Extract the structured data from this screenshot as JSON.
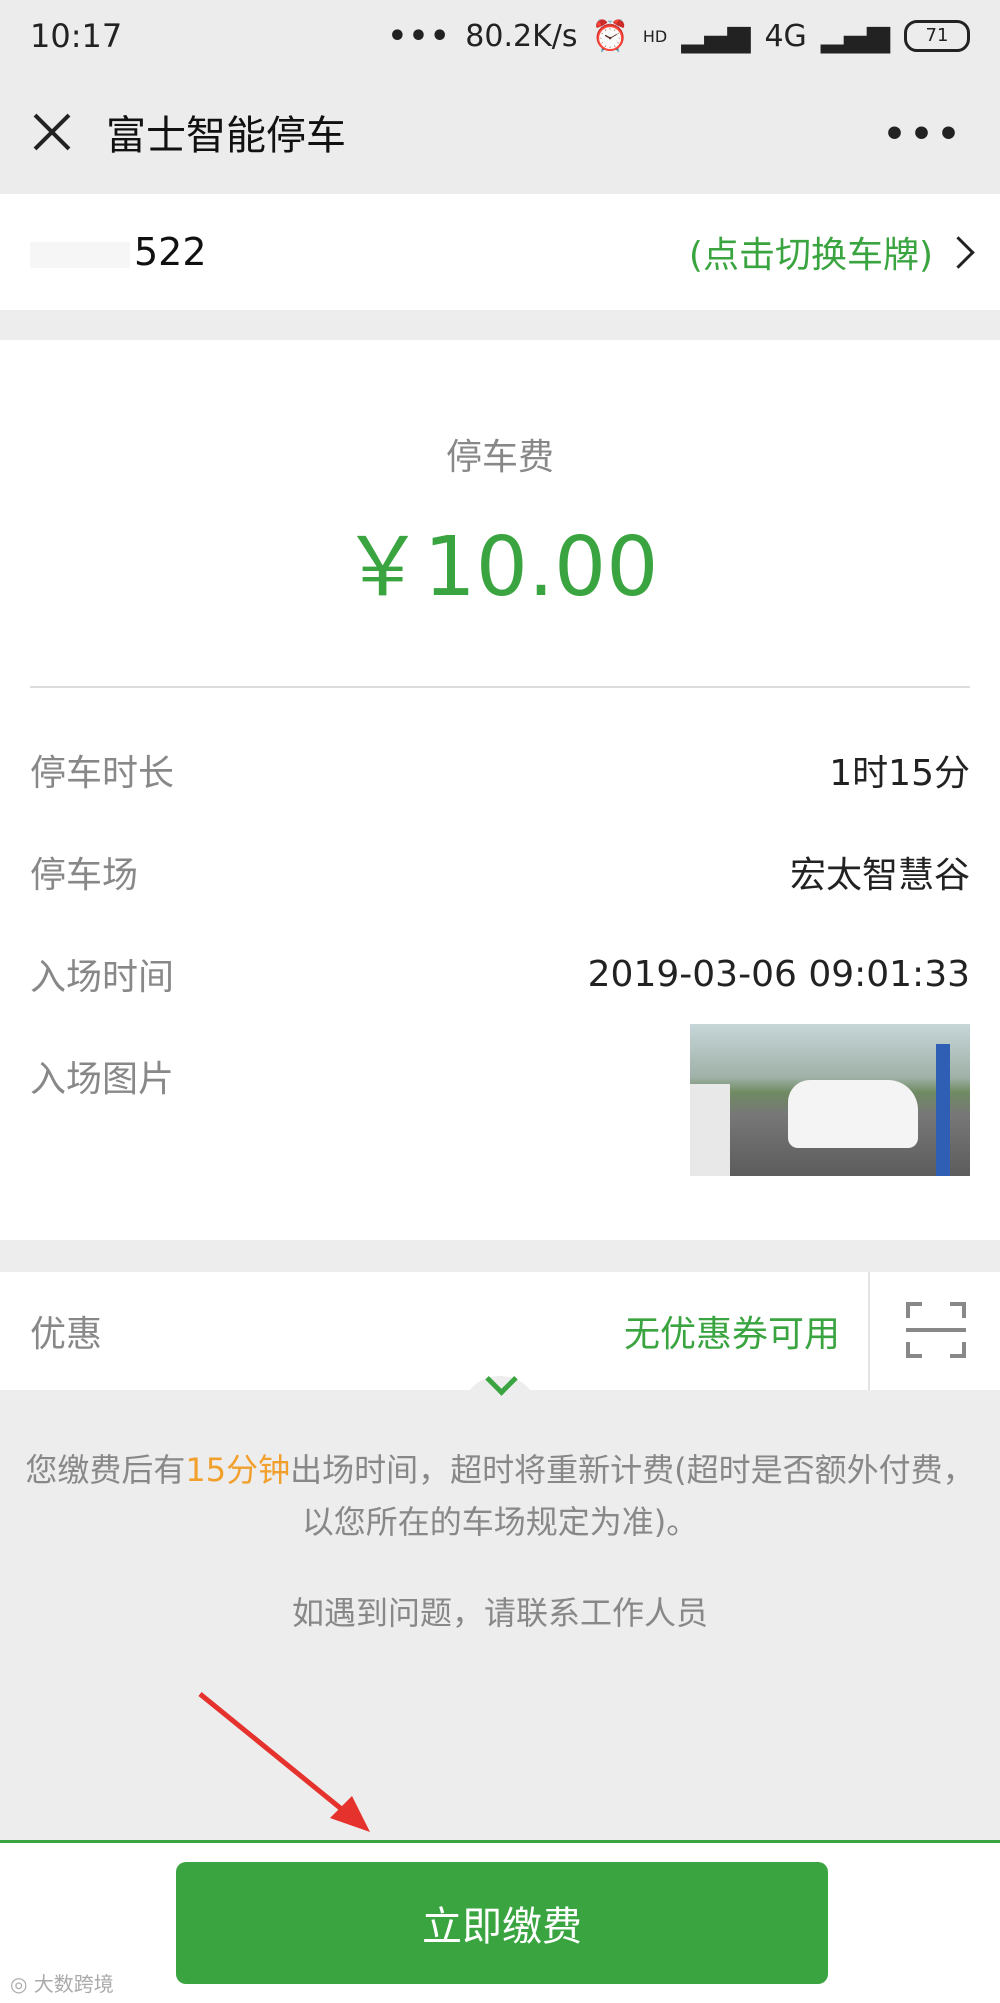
{
  "status_bar": {
    "time": "10:17",
    "network_speed": "80.2K/s",
    "network_type": "4G",
    "hd_label": "HD",
    "battery": "71",
    "icons": [
      "alarm-icon",
      "signal-icon",
      "wifi-icon",
      "battery-icon"
    ]
  },
  "nav": {
    "title": "富士智能停车",
    "close_icon": "close-icon",
    "more_label": "•••"
  },
  "plate": {
    "number_visible": "522",
    "switch_label": "(点击切换车牌)"
  },
  "fee": {
    "label": "停车费",
    "amount": "￥10.00"
  },
  "details": [
    {
      "label": "停车时长",
      "value": "1时15分"
    },
    {
      "label": "停车场",
      "value": "宏太智慧谷"
    },
    {
      "label": "入场时间",
      "value": "2019-03-06 09:01:33"
    },
    {
      "label": "入场图片",
      "value": ""
    }
  ],
  "discount": {
    "label": "优惠",
    "value": "无优惠券可用",
    "scan_icon": "scan-icon"
  },
  "notice": {
    "part1": "您缴费后有",
    "highlight": "15分钟",
    "part2": "出场时间，超时将重新计费(超时是否额外付费，以您所在的车场规定为准)。",
    "contact": "如遇到问题，请联系工作人员"
  },
  "action": {
    "pay_label": "立即缴费"
  },
  "colors": {
    "accent_green": "#3aa540",
    "highlight_orange": "#f2a02d",
    "arrow_red": "#e5322d"
  }
}
